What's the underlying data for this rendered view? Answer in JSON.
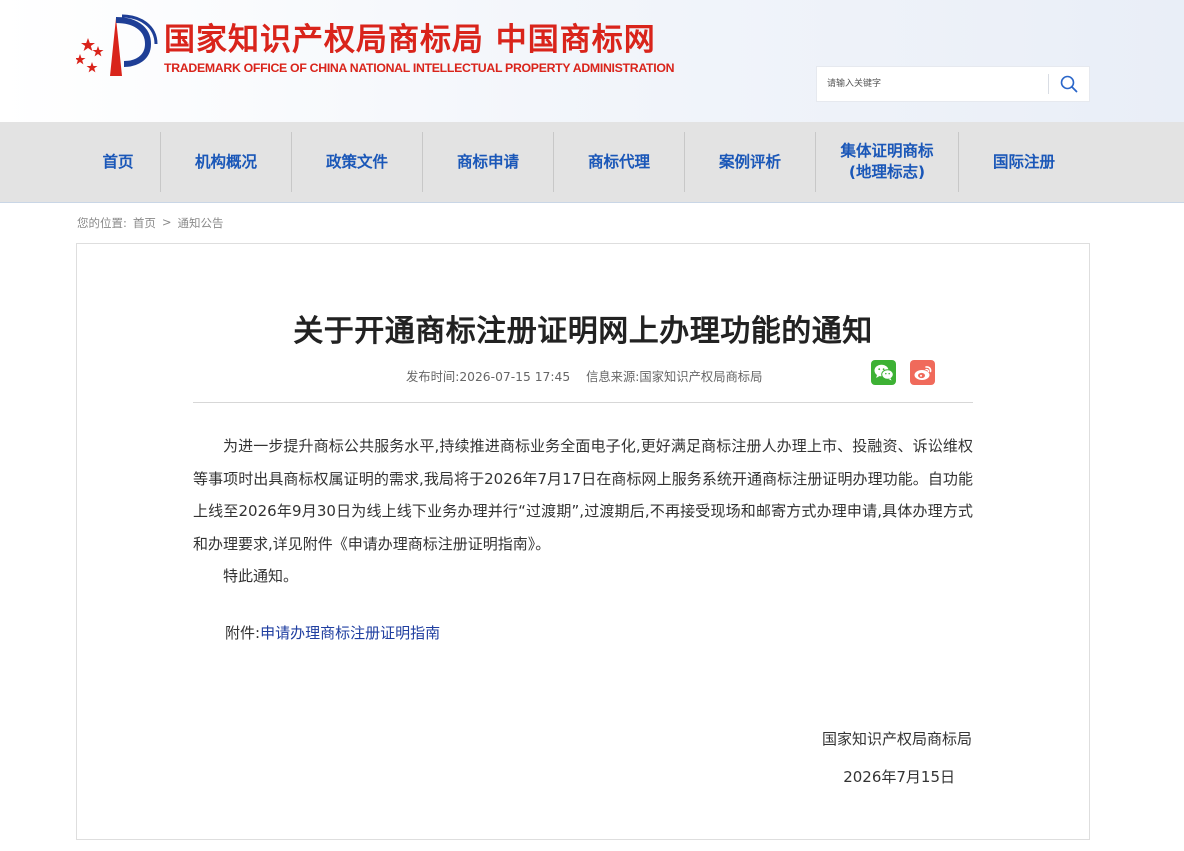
{
  "header": {
    "logo_cn": "国家知识产权局商标局 中国商标网",
    "logo_en": "TRADEMARK OFFICE OF CHINA NATIONAL INTELLECTUAL PROPERTY ADMINISTRATION",
    "search_placeholder": "请输入关键字"
  },
  "nav": {
    "items": [
      {
        "label": "首页"
      },
      {
        "label": "机构概况"
      },
      {
        "label": "政策文件"
      },
      {
        "label": "商标申请"
      },
      {
        "label": "商标代理"
      },
      {
        "label": "案例评析"
      },
      {
        "label": "集体证明商标",
        "label2": "(地理标志)"
      },
      {
        "label": "国际注册"
      }
    ]
  },
  "breadcrumb": {
    "prefix": "您的位置:",
    "home": "首页",
    "sep": ">",
    "current": "通知公告"
  },
  "article": {
    "title": "关于开通商标注册证明网上办理功能的通知",
    "publish": "发布时间:2026-07-15 17:45",
    "source": "信息来源:国家知识产权局商标局",
    "paragraph1": "为进一步提升商标公共服务水平,持续推进商标业务全面电子化,更好满足商标注册人办理上市、投融资、诉讼维权等事项时出具商标权属证明的需求,我局将于2026年7月17日在商标网上服务系统开通商标注册证明办理功能。自功能上线至2026年9月30日为线上线下业务办理并行“过渡期”,过渡期后,不再接受现场和邮寄方式办理申请,具体办理方式和办理要求,详见附件《申请办理商标注册证明指南》。",
    "paragraph2": "特此通知。",
    "attach_label": "附件:",
    "attach_link": "申请办理商标注册证明指南",
    "sign_org": "国家知识产权局商标局",
    "sign_date": "2026年7月15日"
  },
  "colors": {
    "brand_red": "#d9241b",
    "nav_blue": "#1a57b8",
    "wechat_green": "#3db134",
    "weibo_red": "#f06a5b",
    "link_blue": "#1f3ea0"
  },
  "icons": [
    "logo-emblem-icon",
    "search-icon",
    "wechat-icon",
    "weibo-icon"
  ]
}
